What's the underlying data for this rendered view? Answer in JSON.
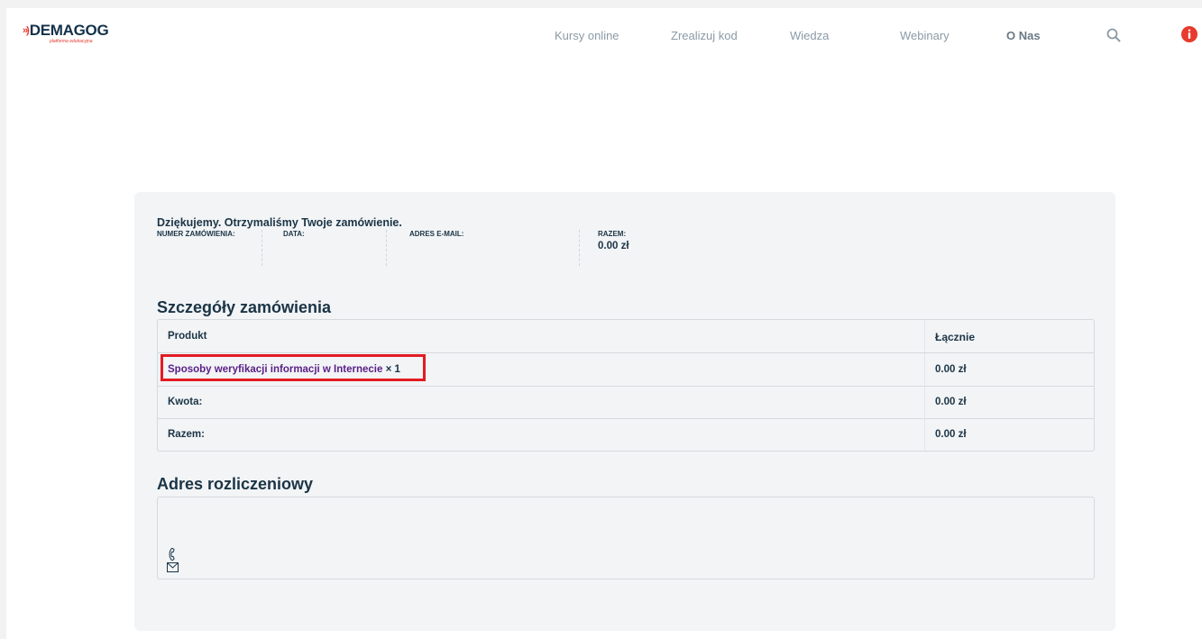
{
  "header": {
    "logo_mark": "»)",
    "logo_text": "DEMAGOG",
    "logo_tagline": "platforma edukacyjna",
    "nav": [
      {
        "label": "Kursy online"
      },
      {
        "label": "Zrealizuj kod"
      },
      {
        "label": "Wiedza"
      },
      {
        "label": "Webinary"
      },
      {
        "label": "O Nas"
      }
    ],
    "search_icon": "search-icon",
    "alert_icon": "alert-icon",
    "alert_color": "#e63b2e"
  },
  "order": {
    "thanks": "Dziękujemy. Otrzymaliśmy Twoje zamówienie.",
    "meta": {
      "order_number_label": "NUMER ZAMÓWIENIA:",
      "date_label": "DATA:",
      "email_label": "ADRES E-MAIL:",
      "total_label": "RAZEM:",
      "total_value": "0.00 zł"
    },
    "details_title": "Szczegóły zamówienia",
    "table": {
      "col_product": "Produkt",
      "col_total": "Łącznie",
      "product_name": "Sposoby weryfikacji informacji w Internecie",
      "product_qty": "× 1",
      "product_total": "0.00 zł",
      "amount_label": "Kwota:",
      "amount_value": "0.00 zł",
      "sum_label": "Razem:",
      "sum_value": "0.00 zł"
    },
    "billing_title": "Adres rozliczeniowy",
    "billing_icons": [
      "phone-icon",
      "mail-icon"
    ]
  },
  "colors": {
    "brand": "#13324a",
    "accent": "#e63b2e",
    "product_link": "#5a1f86",
    "highlight": "#e31b23"
  }
}
